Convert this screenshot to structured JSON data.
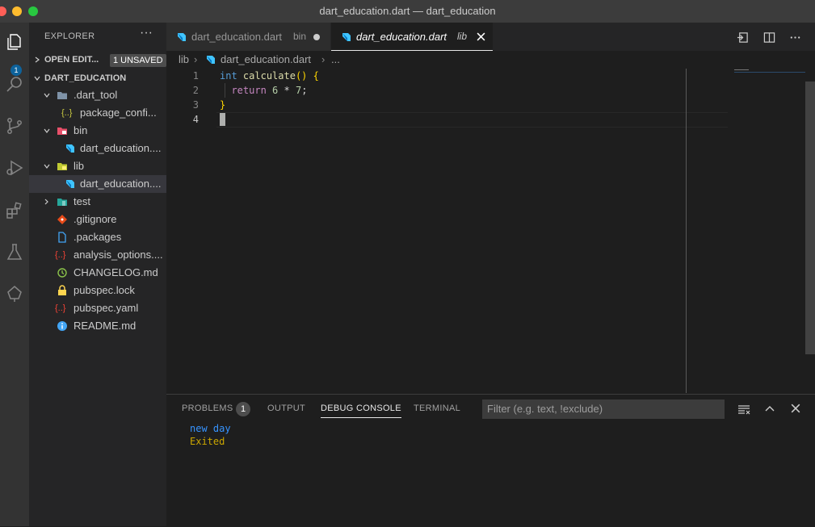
{
  "window": {
    "title": "dart_education.dart — dart_education"
  },
  "activity": {
    "badge": "1"
  },
  "sidebar": {
    "title": "EXPLORER",
    "more": "···",
    "open_editors": {
      "label": "OPEN EDIT...",
      "badge": "1 UNSAVED"
    },
    "project": {
      "label": "DART_EDUCATION"
    },
    "items": [
      {
        "label": ".dart_tool",
        "icon": "folder-icon"
      },
      {
        "label": "package_confi...",
        "icon": "json-icon"
      },
      {
        "label": "bin",
        "icon": "folder-bin-icon"
      },
      {
        "label": "dart_education....",
        "icon": "dart-icon"
      },
      {
        "label": "lib",
        "icon": "folder-lib-icon"
      },
      {
        "label": "dart_education....",
        "icon": "dart-icon"
      },
      {
        "label": "test",
        "icon": "folder-test-icon"
      },
      {
        "label": ".gitignore",
        "icon": "git-icon"
      },
      {
        "label": ".packages",
        "icon": "file-icon"
      },
      {
        "label": "analysis_options....",
        "icon": "yaml-icon"
      },
      {
        "label": "CHANGELOG.md",
        "icon": "history-icon"
      },
      {
        "label": "pubspec.lock",
        "icon": "lock-icon"
      },
      {
        "label": "pubspec.yaml",
        "icon": "yaml-icon"
      },
      {
        "label": "README.md",
        "icon": "info-icon"
      }
    ]
  },
  "tabs": [
    {
      "label": "dart_education.dart",
      "hint": "bin",
      "state": "unsaved"
    },
    {
      "label": "dart_education.dart",
      "hint": "lib",
      "state": "active"
    }
  ],
  "breadcrumb": {
    "folder": "lib",
    "file": "dart_education.dart",
    "more": "..."
  },
  "editor": {
    "lines": [
      {
        "n": "1",
        "tokens": [
          [
            "int",
            "#569cd6"
          ],
          [
            " ",
            "#d4d4d4"
          ],
          [
            "calculate",
            "#dcdcaa"
          ],
          [
            "() ",
            "#ffd700"
          ],
          [
            "{",
            "#ffd700"
          ]
        ]
      },
      {
        "n": "2",
        "tokens": [
          [
            "  ",
            "#d4d4d4"
          ],
          [
            "return",
            "#c586c0"
          ],
          [
            " ",
            "#d4d4d4"
          ],
          [
            "6",
            "#b5cea8"
          ],
          [
            " * ",
            "#d4d4d4"
          ],
          [
            "7",
            "#b5cea8"
          ],
          [
            ";",
            "#d4d4d4"
          ]
        ]
      },
      {
        "n": "3",
        "tokens": [
          [
            "}",
            "#ffd700"
          ]
        ]
      },
      {
        "n": "4",
        "tokens": []
      }
    ]
  },
  "panel": {
    "tabs": [
      "PROBLEMS",
      "OUTPUT",
      "DEBUG CONSOLE",
      "TERMINAL"
    ],
    "problems_count": "1",
    "filter_placeholder": "Filter (e.g. text, !exclude)",
    "output": [
      {
        "text": "new day",
        "color": "#3794ff"
      },
      {
        "text": "Exited",
        "color": "#cca700"
      }
    ]
  },
  "colors": {
    "accent": "#0e639c",
    "active_tab_border": "#e7e7e7"
  }
}
